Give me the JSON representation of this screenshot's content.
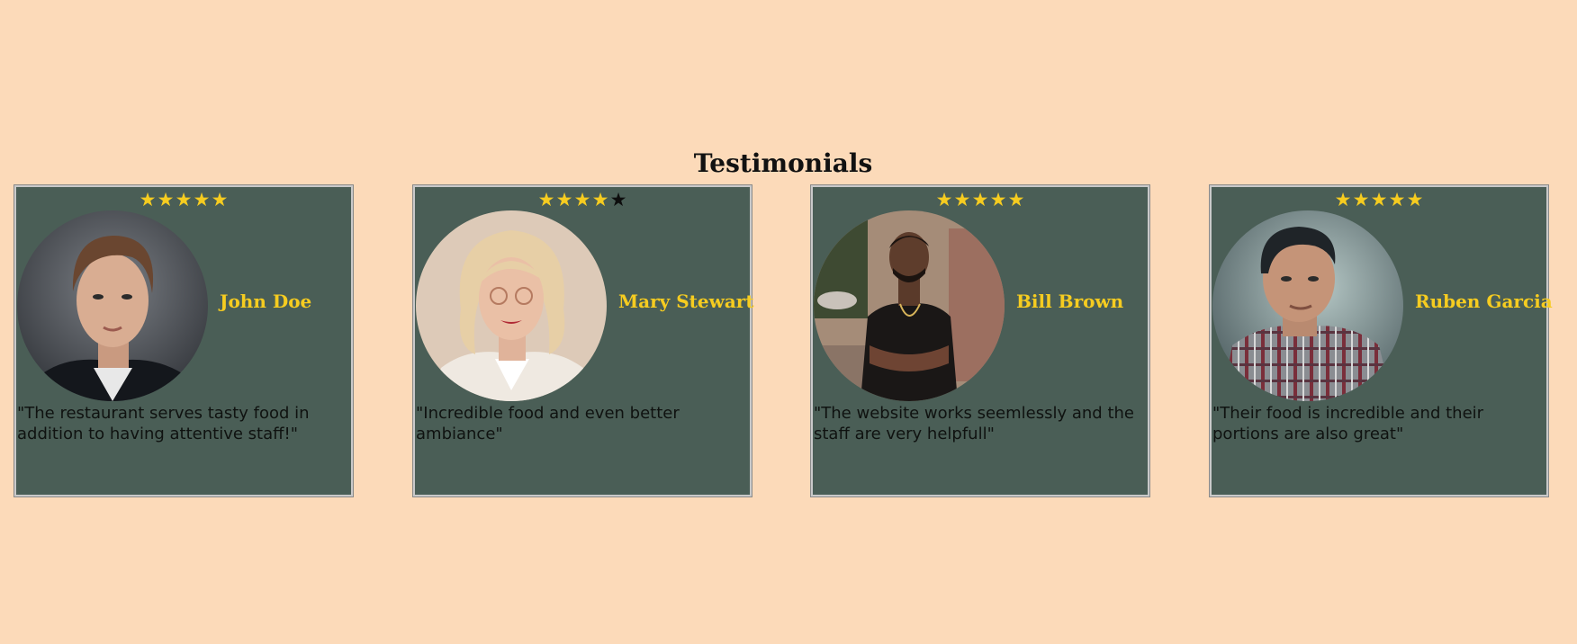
{
  "section": {
    "title": "Testimonials"
  },
  "colors": {
    "page_background": "#fcdab9",
    "card_background": "#4a5e56",
    "star_filled": "#f6cc20",
    "star_empty": "#0d0d0d",
    "name_text": "#f6cc20"
  },
  "testimonials": [
    {
      "name": "John Doe",
      "rating": 5,
      "max_rating": 5,
      "quote": "\"The restaurant serves tasty food in addition to having attentive staff!\"",
      "avatar_icon": "young-man-portrait"
    },
    {
      "name": "Mary Stewart",
      "rating": 4,
      "max_rating": 5,
      "quote": "\"Incredible food and even better ambiance\"",
      "avatar_icon": "blonde-woman-portrait"
    },
    {
      "name": "Bill Brown",
      "rating": 5,
      "max_rating": 5,
      "quote": "\"The website works seemlessly and the staff are very helpfull\"",
      "avatar_icon": "man-street-portrait"
    },
    {
      "name": "Ruben Garcia",
      "rating": 5,
      "max_rating": 5,
      "quote": "\"Their food is incredible and their portions are also great\"",
      "avatar_icon": "man-plaid-shirt-portrait"
    }
  ]
}
